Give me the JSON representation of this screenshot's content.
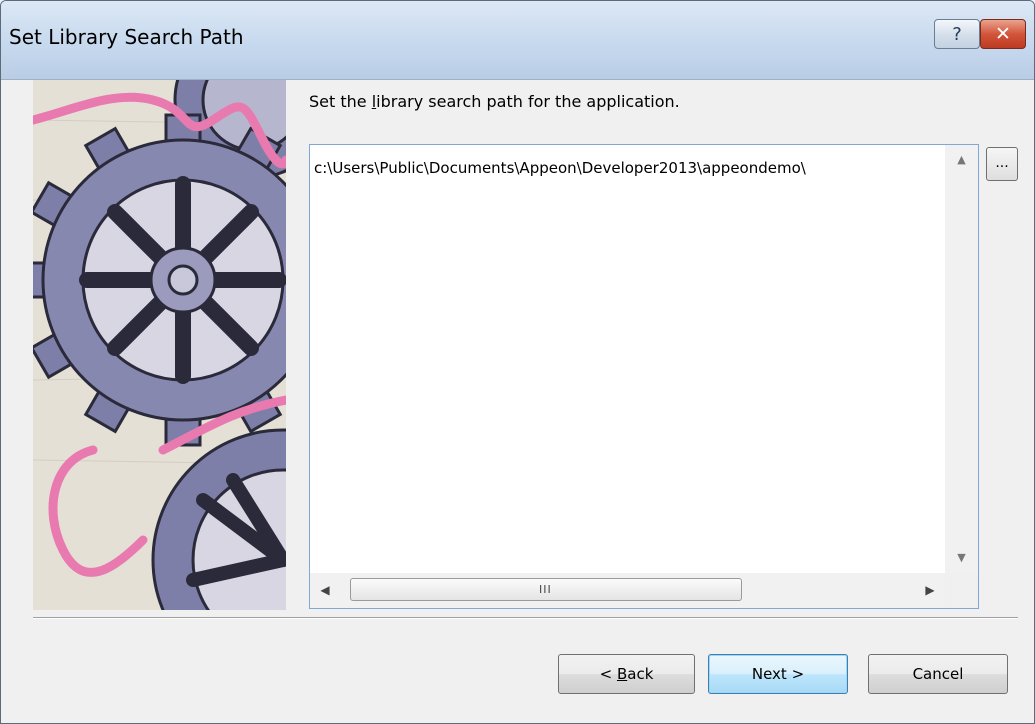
{
  "window": {
    "title": "Set Library Search Path",
    "help_glyph": "?",
    "close_glyph": "✕"
  },
  "main": {
    "prompt_pre": "Set the ",
    "prompt_accel": "l",
    "prompt_post": "ibrary search path for the application.",
    "path_value": "c:\\Users\\Public\\Documents\\Appeon\\Developer2013\\appeondemo\\",
    "browse_label": "..."
  },
  "buttons": {
    "back_pre": "< ",
    "back_accel": "B",
    "back_post": "ack",
    "next": "Next >",
    "cancel": "Cancel"
  },
  "colors": {
    "gear": "#7e7fa8",
    "ribbon": "#e87ab0",
    "accent": "#3c7fb1"
  },
  "icons": {
    "scroll_up": "scroll-up-arrow-icon",
    "scroll_down": "scroll-down-arrow-icon",
    "scroll_left": "scroll-left-arrow-icon",
    "scroll_right": "scroll-right-arrow-icon"
  }
}
